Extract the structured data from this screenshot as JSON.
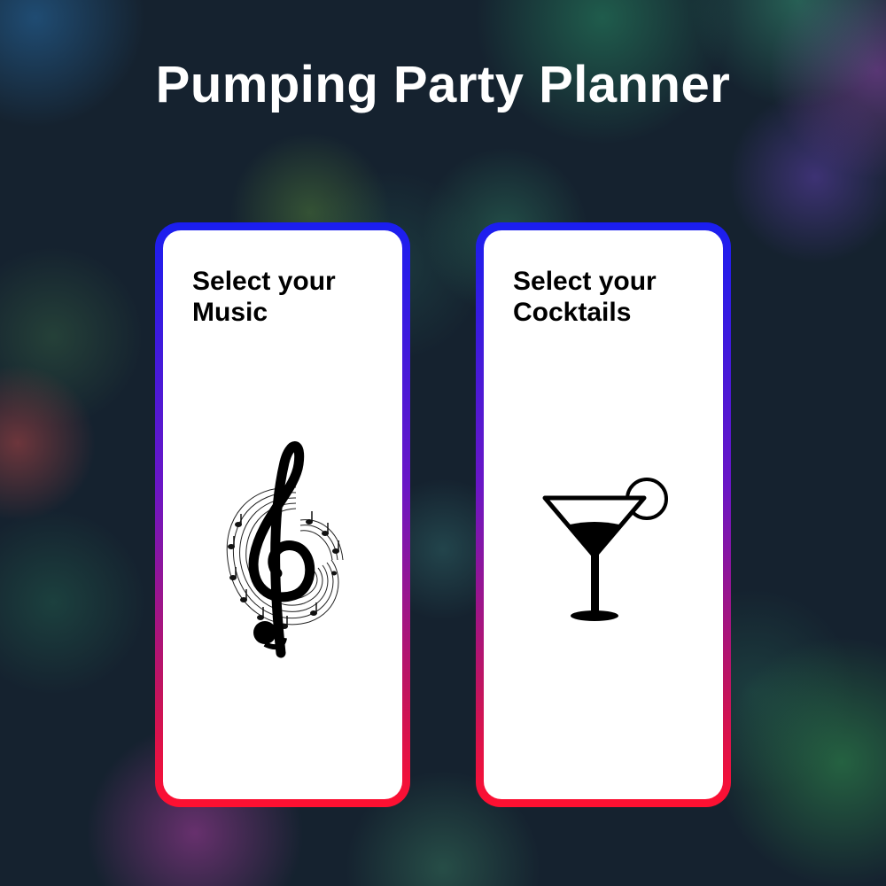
{
  "app": {
    "title": "Pumping Party Planner"
  },
  "cards": [
    {
      "id": "music",
      "label": "Select your Music",
      "icon": "treble-clef-icon"
    },
    {
      "id": "cocktails",
      "label": "Select your Cocktails",
      "icon": "cocktail-glass-icon"
    }
  ],
  "colors": {
    "card_border_top": "#1a1ef0",
    "card_border_bottom": "#ff1030",
    "card_fill": "#ffffff",
    "title_text": "#ffffff",
    "background": "#15222f"
  }
}
